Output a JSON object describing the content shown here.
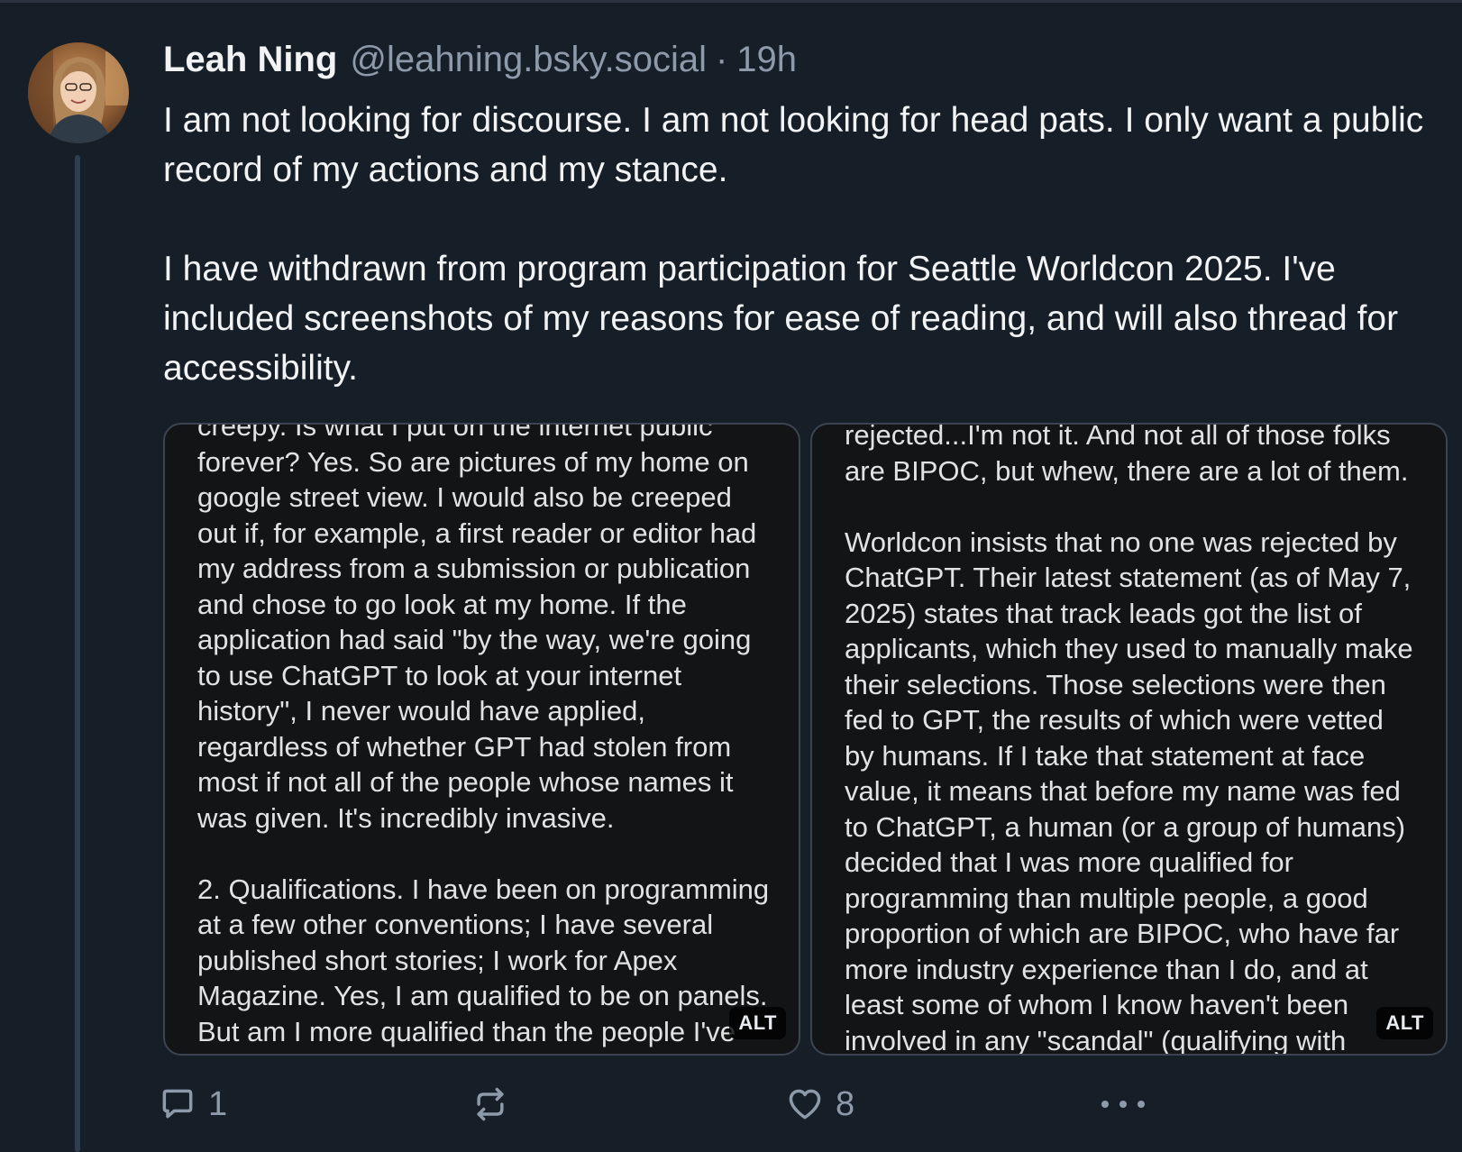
{
  "post": {
    "author_name": "Leah Ning",
    "handle": "@leahning.bsky.social",
    "separator": "·",
    "time": "19h",
    "paragraphs": [
      "I am not looking for discourse. I am not looking for head pats. I only want a public record of my actions and my stance.",
      "I have withdrawn from program participation for Seattle Worldcon 2025. I've included screenshots of my reasons for ease of reading, and will also thread for accessibility."
    ]
  },
  "images": [
    {
      "alt_label": "ALT",
      "lines": [
        "creepy. Is what I put on the internet public",
        "forever? Yes. So are pictures of my home on",
        "google street view. I would also be creeped",
        "out if, for example, a first reader or editor had",
        "my address from a submission or publication",
        "and chose to go look at my home. If the",
        "application had said \"by the way, we're going",
        "to use ChatGPT to look at your internet",
        "history\", I never would have applied,",
        "regardless of whether GPT had stolen from",
        "most if not all of the people whose names it",
        "was given. It's incredibly invasive.",
        "",
        "2. Qualifications. I have been on programming",
        "at a few other conventions; I have several",
        "published short stories; I work for Apex",
        "Magazine. Yes, I am qualified to be on panels.",
        "But am I more qualified than the people I've"
      ]
    },
    {
      "alt_label": "ALT",
      "lines": [
        "rejected...I'm not it. And not all of those folks",
        "are BIPOC, but whew, there are a lot of them.",
        "",
        "Worldcon insists that no one was rejected by",
        "ChatGPT. Their latest statement (as of May 7,",
        "2025) states that track leads got the list of",
        "applicants, which they used to manually make",
        "their selections. Those selections were then",
        "fed to GPT, the results of which were vetted",
        "by humans. If I take that statement at face",
        "value, it means that before my name was fed",
        "to ChatGPT, a human (or a group of humans)",
        "decided that I was more qualified for",
        "programming than multiple people, a good",
        "proportion of which are BIPOC, who have far",
        "more industry experience than I do, and at",
        "least some of whom I know haven't been",
        "involved in any \"scandal\" (qualifying with"
      ]
    }
  ],
  "actions": {
    "reply_count": "1",
    "repost_count": "",
    "like_count": "8"
  },
  "icons": {
    "reply": "reply-icon",
    "repost": "repost-icon",
    "like": "heart-icon",
    "more": "more-icon"
  },
  "colors": {
    "background": "#161e27",
    "text": "#f1f3f5",
    "muted": "#8d9aa9",
    "thread_line": "#2e3d4f"
  }
}
